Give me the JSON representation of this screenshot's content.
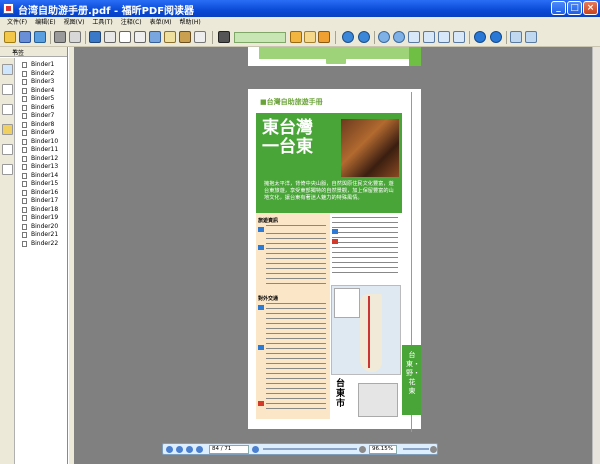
{
  "window": {
    "title": "台湾自助游手册.pdf - 福昕PDF阅读器",
    "minimize": "_",
    "maximize": "□",
    "close": "×"
  },
  "menu": [
    "文件(F)",
    "编辑(E)",
    "视图(V)",
    "工具(T)",
    "注释(C)",
    "表单(M)",
    "帮助(H)"
  ],
  "sidebar": {
    "header": "书签",
    "close": "×",
    "bookmarks": [
      "Binder1",
      "Binder2",
      "Binder3",
      "Binder4",
      "Binder5",
      "Binder6",
      "Binder7",
      "Binder8",
      "Binder9",
      "Binder10",
      "Binder11",
      "Binder12",
      "Binder13",
      "Binder14",
      "Binder15",
      "Binder16",
      "Binder17",
      "Binder18",
      "Binder19",
      "Binder20",
      "Binder21",
      "Binder22"
    ]
  },
  "page": {
    "header": "■台灣自助旅遊手冊",
    "big_title_1": "東台灣",
    "big_title_2": "一台東",
    "description": "擁抱太平洋，背倚中央山脈，自然與原住民文化豐富，遊台東旅遊，享受東部獨特的自然景觀，加上保留豐富的山地文化，讓台東有著迷人魅力的特殊風情。",
    "info_title": "旅遊資訊",
    "transport_title": "對外交通",
    "side_text": "台東・野・花東",
    "map_label": "台東市"
  },
  "status": {
    "page_display": "84 / 71",
    "zoom_display": "96.15%"
  },
  "colors": {
    "titlebar": "#0a4ad6",
    "page_green": "#49a538",
    "sidebar_tab_green": "#6fbf45"
  }
}
